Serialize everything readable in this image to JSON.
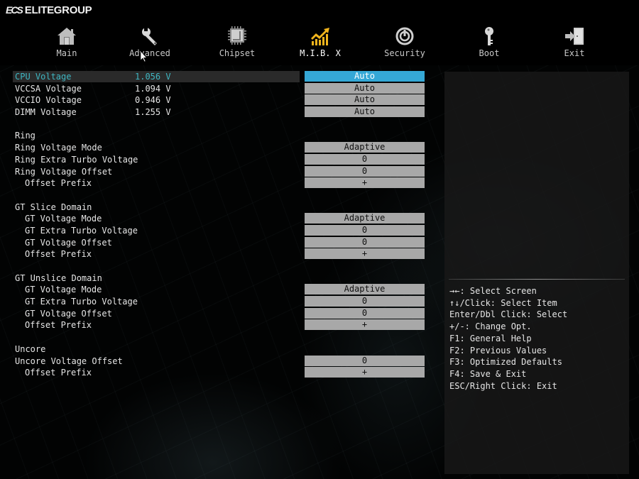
{
  "brand": {
    "mark": "ECS",
    "name": "ELITEGROUP"
  },
  "nav": {
    "active_index": 3,
    "items": [
      {
        "label": "Main",
        "icon": "home-icon"
      },
      {
        "label": "Advanced",
        "icon": "wrench-icon"
      },
      {
        "label": "Chipset",
        "icon": "chip-icon"
      },
      {
        "label": "M.I.B. X",
        "icon": "growth-chart-icon"
      },
      {
        "label": "Security",
        "icon": "power-shield-icon"
      },
      {
        "label": "Boot",
        "icon": "key-icon"
      },
      {
        "label": "Exit",
        "icon": "exit-door-icon"
      }
    ]
  },
  "colors": {
    "accent": "#35a8d6",
    "selected_text": "#3fb6c2",
    "active_icon": "#f2b51d",
    "option_bg": "#a8a8a8"
  },
  "settings": [
    {
      "label": "CPU Voltage",
      "value": "1.056 V",
      "option": "Auto",
      "selected": true
    },
    {
      "label": "VCCSA Voltage",
      "value": "1.094 V",
      "option": "Auto"
    },
    {
      "label": "VCCIO Voltage",
      "value": "0.946 V",
      "option": "Auto"
    },
    {
      "label": "DIMM Voltage",
      "value": "1.255 V",
      "option": "Auto"
    },
    {
      "label": ""
    },
    {
      "label": "Ring"
    },
    {
      "label": "Ring Voltage Mode",
      "option": "Adaptive"
    },
    {
      "label": "Ring Extra Turbo Voltage",
      "option": "0"
    },
    {
      "label": "Ring Voltage Offset",
      "option": "0"
    },
    {
      "label": "Offset Prefix",
      "indent": true,
      "option": "+"
    },
    {
      "label": ""
    },
    {
      "label": "GT Slice Domain"
    },
    {
      "label": "GT Voltage Mode",
      "indent": true,
      "option": "Adaptive"
    },
    {
      "label": "GT Extra Turbo Voltage",
      "indent": true,
      "option": "0"
    },
    {
      "label": "GT Voltage Offset",
      "indent": true,
      "option": "0"
    },
    {
      "label": "Offset Prefix",
      "indent": true,
      "option": "+"
    },
    {
      "label": ""
    },
    {
      "label": "GT Unslice Domain"
    },
    {
      "label": "GT Voltage Mode",
      "indent": true,
      "option": "Adaptive"
    },
    {
      "label": "GT Extra Turbo Voltage",
      "indent": true,
      "option": "0"
    },
    {
      "label": "GT Voltage Offset",
      "indent": true,
      "option": "0"
    },
    {
      "label": "Offset Prefix",
      "indent": true,
      "option": "+"
    },
    {
      "label": ""
    },
    {
      "label": "Uncore"
    },
    {
      "label": "Uncore Voltage Offset",
      "option": "0"
    },
    {
      "label": "Offset Prefix",
      "indent": true,
      "option": "+"
    }
  ],
  "help": {
    "keys": [
      "→←: Select Screen",
      "↑↓/Click: Select Item",
      "Enter/Dbl Click: Select",
      "+/-: Change Opt.",
      "F1: General Help",
      "F2: Previous Values",
      "F3: Optimized Defaults",
      "F4: Save & Exit",
      "ESC/Right Click: Exit"
    ]
  }
}
